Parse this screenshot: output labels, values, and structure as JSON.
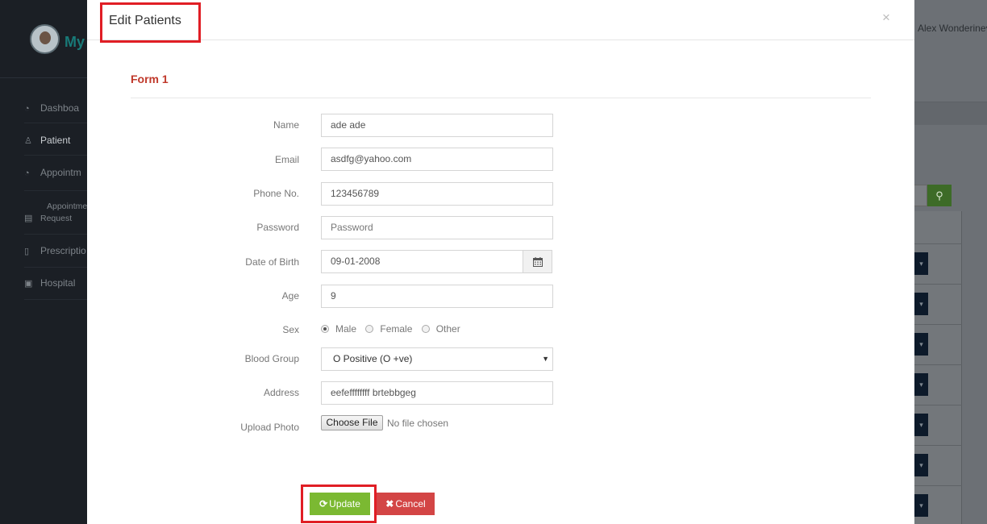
{
  "background": {
    "brand_fragment": "My",
    "user_name": "Alex Wonderine",
    "nav": [
      {
        "icon": "dashboard-icon",
        "label": "Dashboa"
      },
      {
        "icon": "patient-icon",
        "label": "Patient"
      },
      {
        "icon": "appointment-icon",
        "label": "Appointm"
      },
      {
        "icon": "appointment-request-icon",
        "label": "Appointme",
        "label2": "Request"
      },
      {
        "icon": "prescription-icon",
        "label": "Prescriptio"
      },
      {
        "icon": "hospital-icon",
        "label": "Hospital"
      }
    ]
  },
  "modal": {
    "title": "Edit Patients",
    "close_glyph": "×",
    "form_title": "Form 1",
    "fields": {
      "name": {
        "label": "Name",
        "value": "ade ade"
      },
      "email": {
        "label": "Email",
        "value": "asdfg@yahoo.com"
      },
      "phone": {
        "label": "Phone No.",
        "value": "123456789"
      },
      "password": {
        "label": "Password",
        "placeholder": "Password"
      },
      "dob": {
        "label": "Date of Birth",
        "value": "09-01-2008"
      },
      "age": {
        "label": "Age",
        "value": "9"
      },
      "sex": {
        "label": "Sex",
        "options": [
          "Male",
          "Female",
          "Other"
        ],
        "selected": "Male"
      },
      "blood_group": {
        "label": "Blood Group",
        "value": "O Positive (O +ve)"
      },
      "address": {
        "label": "Address",
        "value": "eefeffffffff brtebbgeg"
      },
      "photo": {
        "label": "Upload Photo",
        "button": "Choose File",
        "status": "No file chosen"
      }
    },
    "buttons": {
      "update": "Update",
      "cancel": "Cancel"
    }
  },
  "colors": {
    "update_button": "#7bb932",
    "cancel_button": "#d34545",
    "form_title": "#c0392b",
    "highlight_box": "#e01e25",
    "sidebar": "#1b1f25"
  }
}
